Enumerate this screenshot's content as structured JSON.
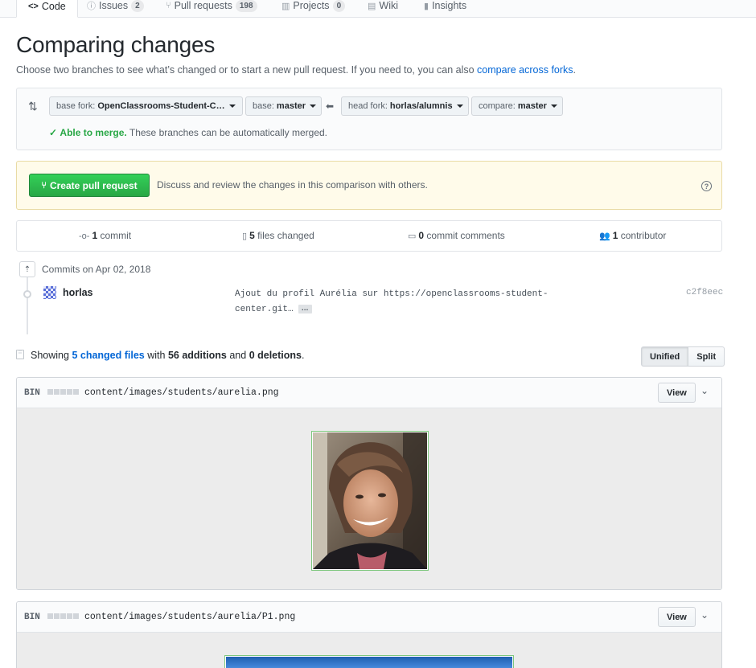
{
  "repo_tabs": [
    {
      "icon": "code-icon",
      "label": "Code",
      "count": null
    },
    {
      "icon": "issue-icon",
      "label": "Issues",
      "count": "2"
    },
    {
      "icon": "pull-request-icon",
      "label": "Pull requests",
      "count": "198"
    },
    {
      "icon": "project-icon",
      "label": "Projects",
      "count": "0"
    },
    {
      "icon": "book-icon",
      "label": "Wiki",
      "count": null
    },
    {
      "icon": "graph-icon",
      "label": "Insights",
      "count": null
    }
  ],
  "page": {
    "title": "Comparing changes",
    "subtitle_prefix": "Choose two branches to see what’s changed or to start a new pull request. If you need to, you can also ",
    "subtitle_link": "compare across forks",
    "subtitle_suffix": "."
  },
  "range": {
    "base_fork_label": "base fork:",
    "base_fork_value": "OpenClassrooms-Student-C…",
    "base_label": "base:",
    "base_value": "master",
    "head_fork_label": "head fork:",
    "head_fork_value": "horlas/alumnis",
    "compare_label": "compare:",
    "compare_value": "master",
    "merge_ok": "Able to merge.",
    "merge_text": " These branches can be automatically merged."
  },
  "pr": {
    "button": "Create pull request",
    "description": "Discuss and review the changes in this comparison with others.",
    "help": "?"
  },
  "summary": {
    "commits_count": "1",
    "commits_label": " commit",
    "files_count": "5",
    "files_label": " files changed",
    "comments_count": "0",
    "comments_label": " commit comments",
    "contributors_count": "1",
    "contributors_label": " contributor"
  },
  "commits": {
    "date_heading": "Commits on Apr 02, 2018",
    "items": [
      {
        "author": "horlas",
        "message": "Ajout du profil Aurélia sur https://openclassrooms-student-center.git…",
        "expander": "…",
        "sha": "c2f8eec"
      }
    ]
  },
  "toc": {
    "prefix": "Showing ",
    "files_link": "5 changed files",
    "middle": " with ",
    "additions": "56 additions",
    "and": " and ",
    "deletions": "0 deletions",
    "suffix": ".",
    "unified_label": "Unified",
    "split_label": "Split"
  },
  "files": [
    {
      "type": "BIN",
      "path": "content/images/students/aurelia.png",
      "view_label": "View"
    },
    {
      "type": "BIN",
      "path": "content/images/students/aurelia/P1.png",
      "view_label": "View"
    }
  ],
  "colors": {
    "accent_link": "#0366d6",
    "success": "#28a745",
    "tab_indicator": "#e36209"
  }
}
